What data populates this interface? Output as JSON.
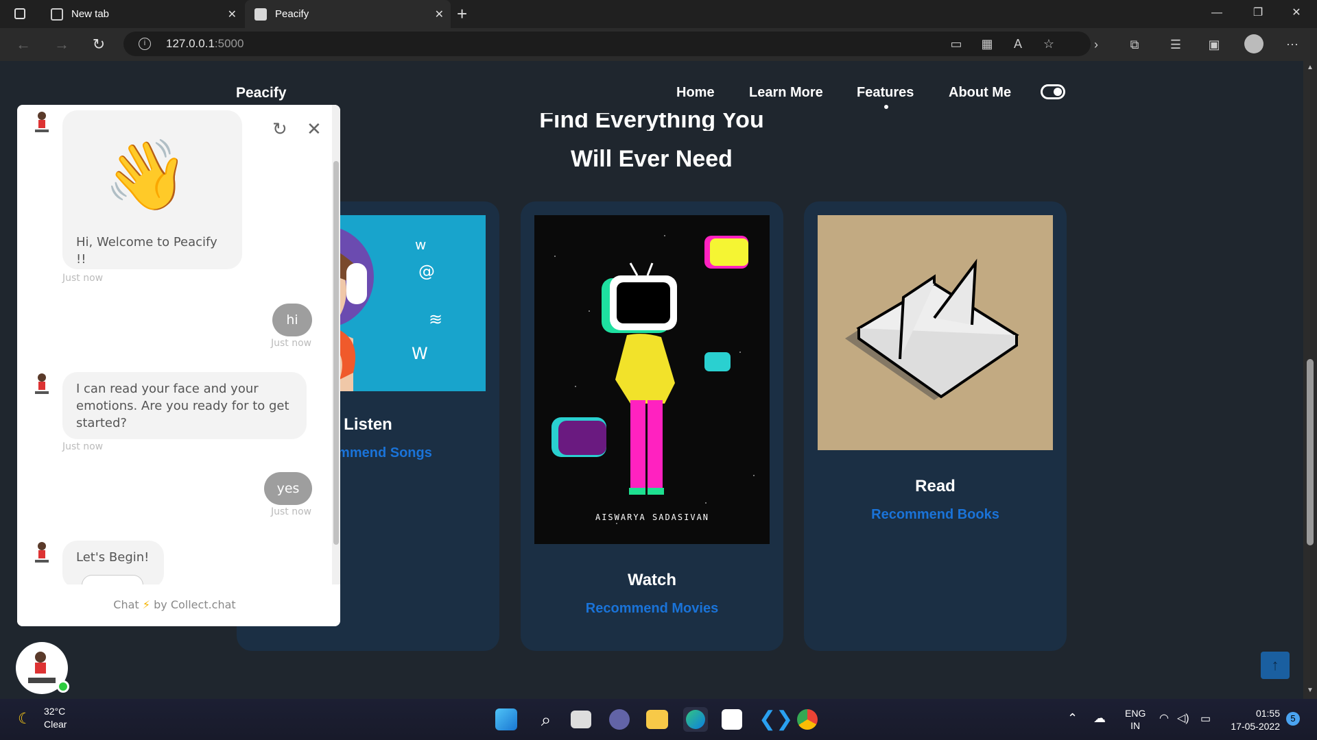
{
  "browser": {
    "tabs": [
      {
        "label": "New tab",
        "active": false
      },
      {
        "label": "Peacify",
        "active": true
      }
    ],
    "url_host": "127.0.0.1",
    "url_port": ":5000"
  },
  "site": {
    "brand": "Peacify",
    "nav": [
      "Home",
      "Learn More",
      "Features",
      "About Me"
    ],
    "heading_line1": "Find Everything You",
    "heading_line2": "Will Ever Need",
    "cards": [
      {
        "title": "Listen",
        "link": "Recommend Songs"
      },
      {
        "title": "Watch",
        "link": "Recommend Movies"
      },
      {
        "title": "Read",
        "link": "Recommend Books"
      }
    ],
    "movie_art_caption": "AISWARYA SADASIVAN"
  },
  "chat": {
    "messages": [
      {
        "from": "bot",
        "text": "Hi, Welcome to Peacify !!",
        "time": "Just now"
      },
      {
        "from": "user",
        "text": "hi",
        "time": "Just now"
      },
      {
        "from": "bot",
        "text": "I can read your face and your emotions. Are you ready for to get started?",
        "time": "Just now"
      },
      {
        "from": "user",
        "text": "yes",
        "time": "Just now"
      },
      {
        "from": "bot",
        "text": "Let's Begin!",
        "time": ""
      }
    ],
    "footer_prefix": "Chat",
    "footer_suffix": "by Collect.chat"
  },
  "taskbar": {
    "temp": "32°C",
    "condition": "Clear",
    "lang": "ENG",
    "region": "IN",
    "time": "01:55",
    "date": "17-05-2022",
    "notifications": "5"
  },
  "colors": {
    "page_bg": "#1f262e",
    "card_bg": "#1b2f44",
    "link": "#1a73d8"
  }
}
